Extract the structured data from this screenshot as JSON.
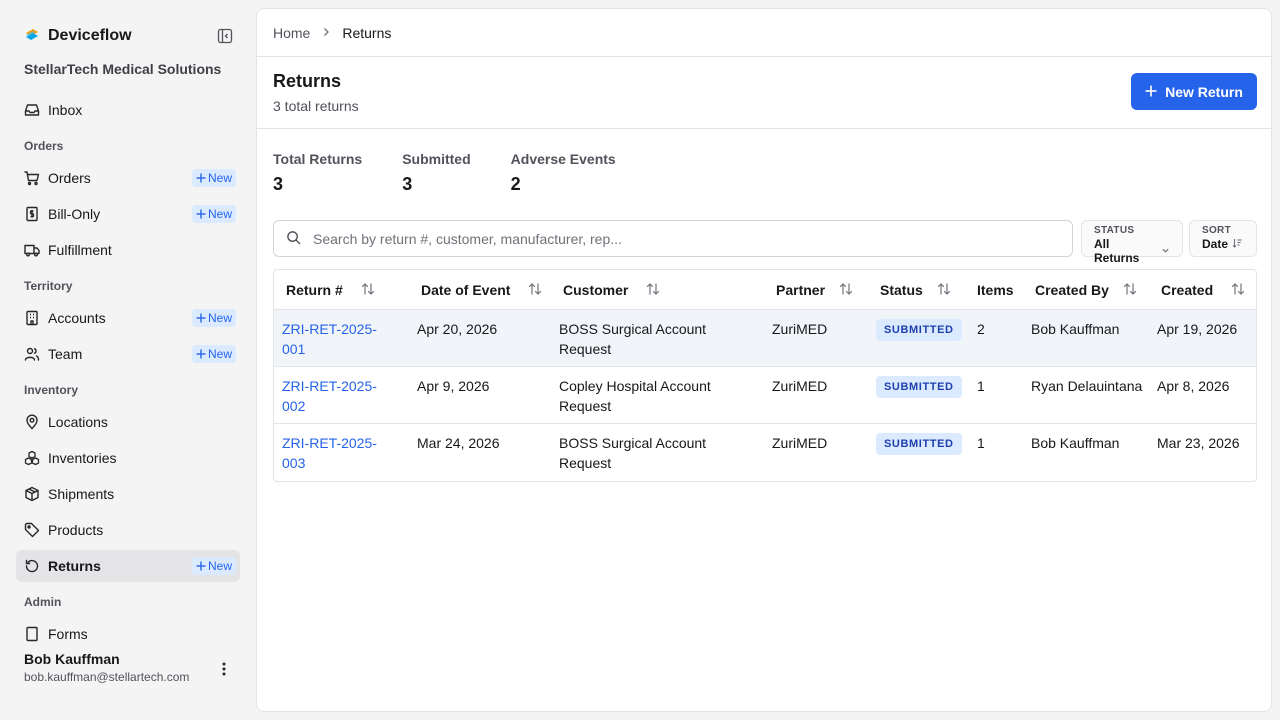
{
  "app": {
    "name": "Deviceflow",
    "org": "StellarTech Medical Solutions"
  },
  "sidebar": {
    "inbox": "Inbox",
    "sections": {
      "orders": "Orders",
      "territory": "Territory",
      "inventory": "Inventory",
      "admin": "Admin"
    },
    "items": {
      "orders": "Orders",
      "bill_only": "Bill-Only",
      "fulfillment": "Fulfillment",
      "accounts": "Accounts",
      "team": "Team",
      "locations": "Locations",
      "inventories": "Inventories",
      "shipments": "Shipments",
      "products": "Products",
      "returns": "Returns",
      "forms": "Forms"
    },
    "new_label": "New"
  },
  "user": {
    "name": "Bob Kauffman",
    "email": "bob.kauffman@stellartech.com"
  },
  "breadcrumb": {
    "home": "Home",
    "current": "Returns"
  },
  "page": {
    "title": "Returns",
    "subtitle": "3 total returns",
    "new_button": "New Return"
  },
  "stats": [
    {
      "label": "Total Returns",
      "value": "3"
    },
    {
      "label": "Submitted",
      "value": "3"
    },
    {
      "label": "Adverse Events",
      "value": "2"
    }
  ],
  "search": {
    "placeholder": "Search by return #, customer, manufacturer, rep..."
  },
  "filters": {
    "status_label": "STATUS",
    "status_value": "All Returns",
    "sort_label": "SORT",
    "sort_value": "Date"
  },
  "table": {
    "headers": {
      "return_no": "Return #",
      "date_of_event": "Date of Event",
      "customer": "Customer",
      "partner": "Partner",
      "status": "Status",
      "items": "Items",
      "created_by": "Created By",
      "created": "Created"
    },
    "rows": [
      {
        "return_no_1": "ZRI-RET-2025-",
        "return_no_2": "001",
        "date_of_event": "Apr 20, 2026",
        "customer_1": "BOSS Surgical Account",
        "customer_2": "Request",
        "partner": "ZuriMED",
        "status": "SUBMITTED",
        "items": "2",
        "created_by": "Bob Kauffman",
        "created": "Apr 19, 2026"
      },
      {
        "return_no_1": "ZRI-RET-2025-",
        "return_no_2": "002",
        "date_of_event": "Apr 9, 2026",
        "customer_1": "Copley Hospital Account",
        "customer_2": "Request",
        "partner": "ZuriMED",
        "status": "SUBMITTED",
        "items": "1",
        "created_by": "Ryan Delauintana",
        "created": "Apr 8, 2026"
      },
      {
        "return_no_1": "ZRI-RET-2025-",
        "return_no_2": "003",
        "date_of_event": "Mar 24, 2026",
        "customer_1": "BOSS Surgical Account",
        "customer_2": "Request",
        "partner": "ZuriMED",
        "status": "SUBMITTED",
        "items": "1",
        "created_by": "Bob Kauffman",
        "created": "Mar 23, 2026"
      }
    ]
  },
  "colors": {
    "accent": "#2563eb",
    "badge_bg": "#dbeafe",
    "badge_text": "#1e40af",
    "sidebar_bg": "#f4f4f5"
  }
}
